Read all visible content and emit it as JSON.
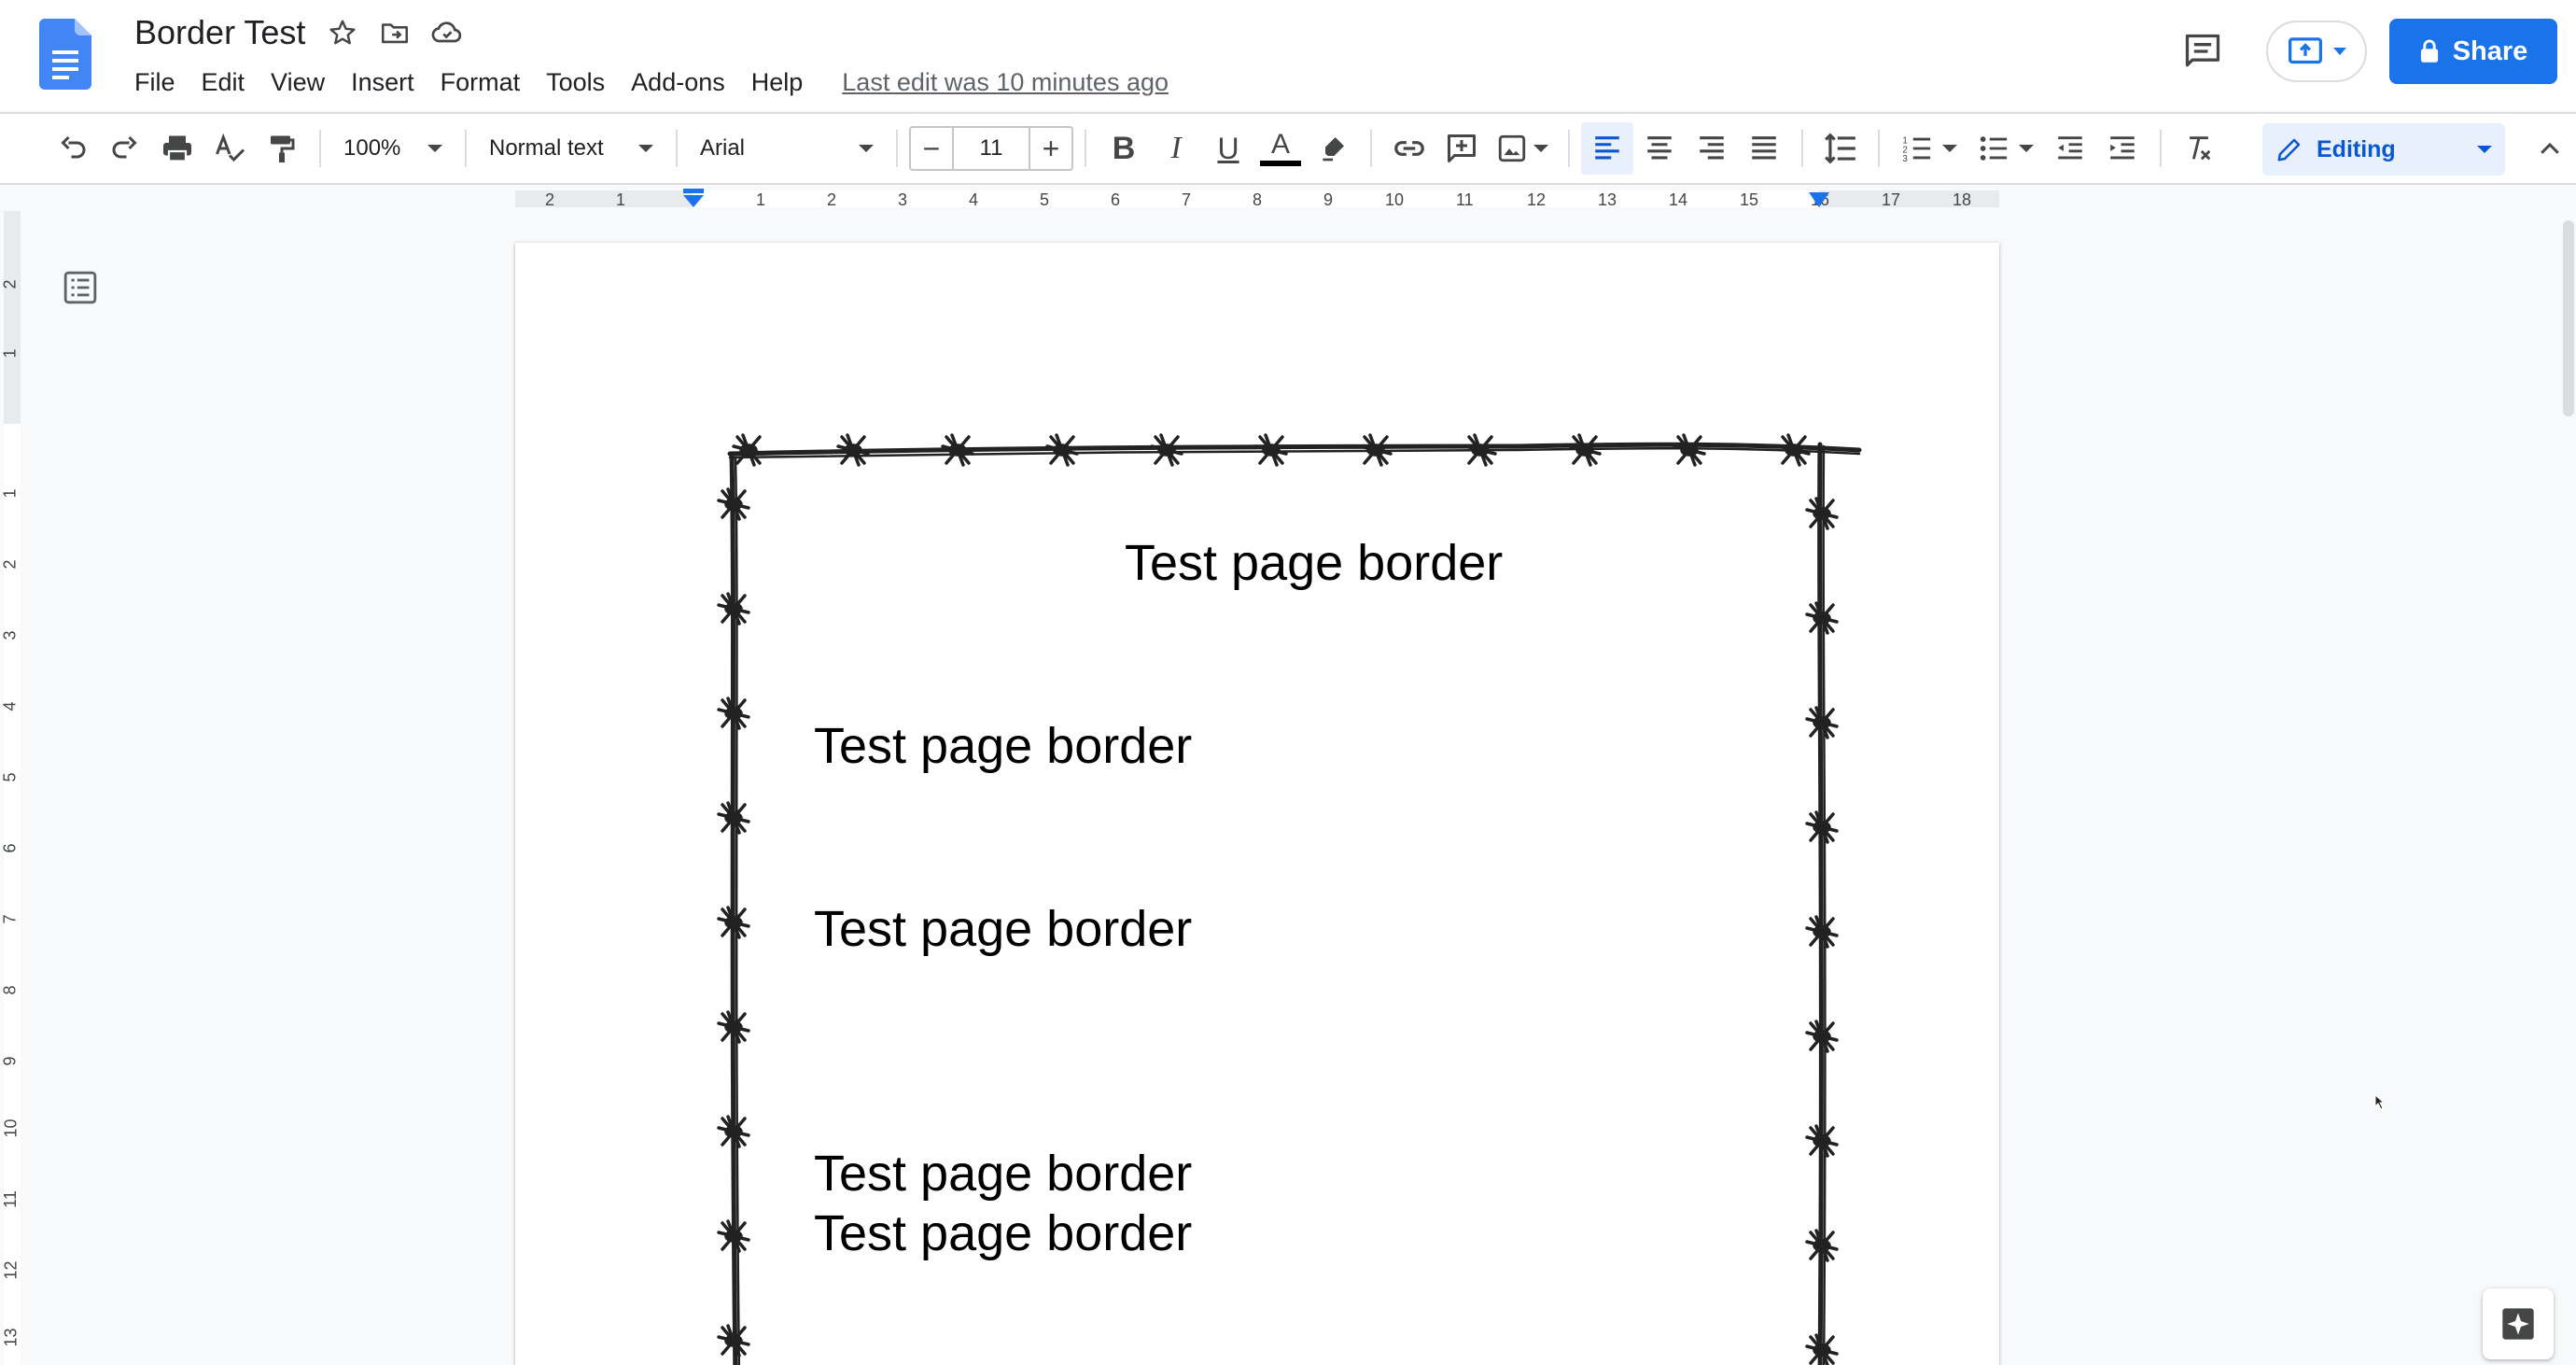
{
  "header": {
    "doc_title": "Border Test",
    "last_edit": "Last edit was 10 minutes ago",
    "share_label": "Share"
  },
  "menu": [
    "File",
    "Edit",
    "View",
    "Insert",
    "Format",
    "Tools",
    "Add-ons",
    "Help"
  ],
  "toolbar": {
    "zoom": "100%",
    "style": "Normal text",
    "font": "Arial",
    "font_size": "11",
    "bold_label": "B",
    "italic_label": "I",
    "underline_label": "U",
    "text_color_label": "A",
    "editing_label": "Editing"
  },
  "ruler": {
    "horizontal_labels": [
      "2",
      "1",
      "1",
      "2",
      "3",
      "4",
      "5",
      "6",
      "7",
      "8",
      "9",
      "10",
      "11",
      "12",
      "13",
      "14",
      "15",
      "16",
      "17",
      "18"
    ],
    "vertical_labels": [
      "2",
      "1",
      "1",
      "2",
      "3",
      "4",
      "5",
      "6",
      "7",
      "8",
      "9",
      "10",
      "11",
      "12",
      "13"
    ]
  },
  "document": {
    "lines": [
      {
        "text": "Test page border",
        "align": "center"
      },
      {
        "text": "Test page border",
        "align": "left"
      },
      {
        "text": "Test page border",
        "align": "left"
      },
      {
        "text": "Test page border",
        "align": "left"
      },
      {
        "text": "Test page border",
        "align": "left"
      }
    ]
  },
  "colors": {
    "accent": "#1a73e8",
    "text_color_bar": "#000000",
    "page_background": "#ffffff",
    "app_background": "#f8f9fa"
  },
  "icons": {
    "logo": "google-docs-icon",
    "star": "star-icon",
    "move": "move-to-folder-icon",
    "cloud": "cloud-saved-icon",
    "comments": "comment-icon",
    "present": "present-icon",
    "lock": "lock-icon"
  }
}
